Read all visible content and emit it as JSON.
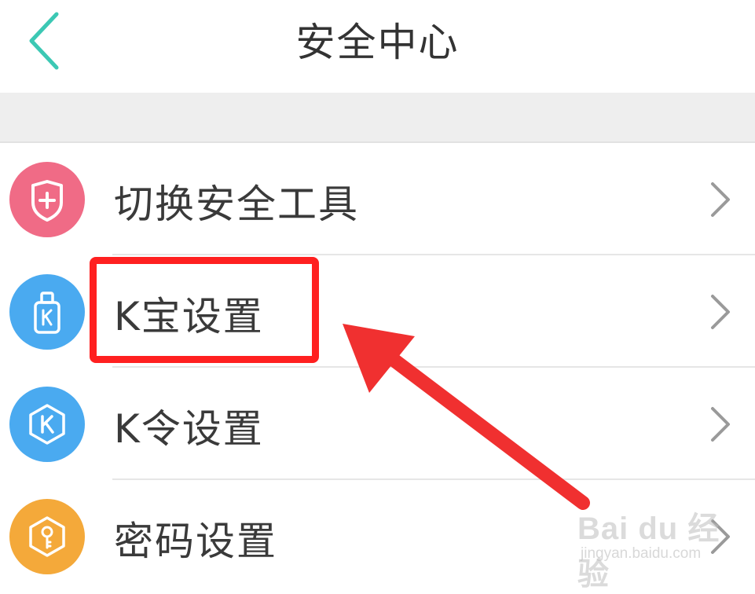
{
  "header": {
    "title": "安全中心",
    "back_icon": "chevron-left-icon",
    "accent_color": "#3cc8b4"
  },
  "menu": {
    "items": [
      {
        "label": "切换安全工具",
        "icon": "shield-plus-icon",
        "icon_color": "#f06b86"
      },
      {
        "label": "K宝设置",
        "icon": "usb-key-icon",
        "icon_color": "#4aaaf0",
        "highlighted": true
      },
      {
        "label": "K令设置",
        "icon": "hexagon-k-icon",
        "icon_color": "#4aaaf0"
      },
      {
        "label": "密码设置",
        "icon": "hexagon-key-icon",
        "icon_color": "#f4a93a"
      }
    ],
    "chevron_icon": "chevron-right-icon"
  },
  "annotation": {
    "highlight_color": "#ff2020",
    "arrow_color": "#f03030"
  },
  "watermark": {
    "main": "Bai du 经验",
    "sub": "jingyan.baidu.com"
  }
}
